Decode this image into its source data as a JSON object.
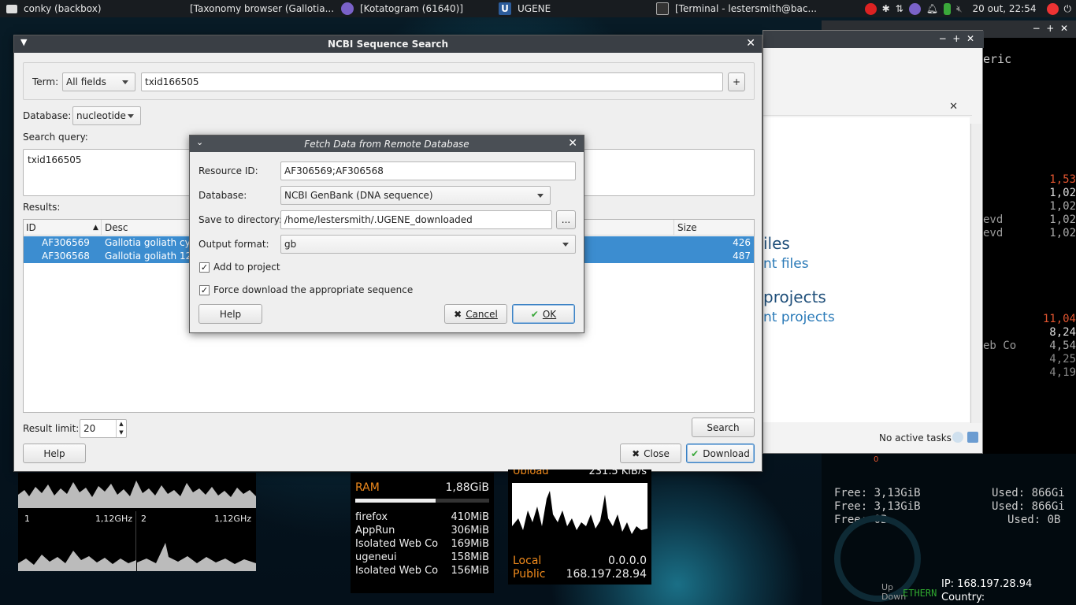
{
  "taskbar": {
    "tasks": [
      {
        "label": "conky (backbox)"
      },
      {
        "label": "[Taxonomy browser (Gallotia..."
      },
      {
        "label": "[Kotatogram (61640)]"
      },
      {
        "label": "UGENE"
      },
      {
        "label": "[Terminal - lestersmith@bac..."
      }
    ],
    "clock": "20 out, 22:54"
  },
  "ncbi_dialog": {
    "title": "NCBI Sequence Search",
    "term_label": "Term:",
    "term_field": "All fields",
    "term_value": "txid166505",
    "add_button": "+",
    "database_label": "Database:",
    "database_value": "nucleotide",
    "search_query_label": "Search query:",
    "search_query_value": "txid166505",
    "results_label": "Results:",
    "columns": [
      "ID",
      "Desc",
      "Size"
    ],
    "rows": [
      {
        "id": "AF306569",
        "desc": "Gallotia goliath cyto",
        "size": "426"
      },
      {
        "id": "AF306568",
        "desc": "Gallotia goliath 12S",
        "size": "487"
      }
    ],
    "result_limit_label": "Result limit:",
    "result_limit_value": "20",
    "search_button": "Search",
    "help_button": "Help",
    "close_button": "Close",
    "download_button": "Download"
  },
  "fetch_dialog": {
    "title": "Fetch Data from Remote Database",
    "resource_id_label": "Resource ID:",
    "resource_id_value": "AF306569;AF306568",
    "database_label": "Database:",
    "database_value": "NCBI GenBank (DNA sequence)",
    "save_dir_label": "Save to directory:",
    "save_dir_value": "/home/lestersmith/.UGENE_downloaded",
    "browse_button": "...",
    "output_format_label": "Output format:",
    "output_format_value": "gb",
    "add_to_project_label": "Add to project",
    "force_download_label": "Force download the appropriate sequence",
    "help_button": "Help",
    "cancel_button": "Cancel",
    "ok_button": "OK"
  },
  "ugene_bg": {
    "files_heading": "iles",
    "files_link": "nt files",
    "projects_heading": "projects",
    "projects_link": "nt projects",
    "status": "No active tasks"
  },
  "terminal": {
    "title": "conky (backbox)",
    "partial_text": "eric",
    "values": [
      {
        "label": "",
        "value": "1,53"
      },
      {
        "label": "",
        "value": "1,02"
      },
      {
        "label": "",
        "value": "1,02"
      },
      {
        "label": "evd",
        "value": "1,02"
      },
      {
        "label": "evd",
        "value": "1,02"
      },
      {
        "label": "",
        "value": "11,04"
      },
      {
        "label": "",
        "value": "8,24"
      },
      {
        "label": "eb Co",
        "value": "4,54"
      },
      {
        "label": "",
        "value": "4,25"
      },
      {
        "label": "",
        "value": "4,19"
      }
    ]
  },
  "conky": {
    "cpu1_label": "1",
    "cpu1_freq": "1,12GHz",
    "cpu2_label": "2",
    "cpu2_freq": "1,12GHz",
    "ram_label": "RAM",
    "ram_value": "1,88GiB",
    "ram_fraction": 0.6,
    "processes": [
      {
        "name": "firefox",
        "mem": "410MiB"
      },
      {
        "name": "AppRun",
        "mem": "306MiB"
      },
      {
        "name": "Isolated Web Co",
        "mem": "169MiB"
      },
      {
        "name": "ugeneui",
        "mem": "158MiB"
      },
      {
        "name": "Isolated Web Co",
        "mem": "156MiB"
      }
    ],
    "upload_label": "Upload",
    "upload_value": "231,5 KiB/s",
    "local_label": "Local",
    "local_value": "0.0.0.0",
    "public_label": "Public",
    "public_value": "168.197.28.94",
    "free1": "Free: 3,13GiB",
    "used1": "Used: 866Gi",
    "free2": "Free: 3,13GiB",
    "used2": "Used: 866Gi",
    "free3": "Free: 0B",
    "used3": "Used: 0B",
    "up_label": "Up",
    "down_label": "Down",
    "ethernet_label": "ETHERN",
    "ip_line": "IP: 168.197.28.94",
    "country_line": "Country:",
    "zero_label": "0"
  }
}
